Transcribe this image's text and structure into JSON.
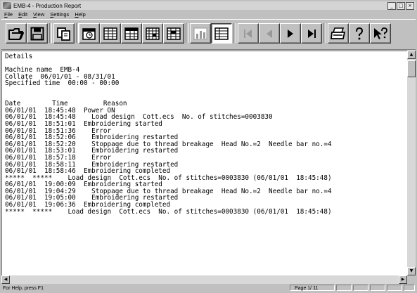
{
  "window": {
    "title": "EMB-4 - Production Report",
    "minimize": "_",
    "maximize": "□",
    "close": "×"
  },
  "menu": [
    {
      "underline": "F",
      "rest": "ile"
    },
    {
      "underline": "E",
      "rest": "dit"
    },
    {
      "underline": "V",
      "rest": "iew"
    },
    {
      "underline": "S",
      "rest": "ettings"
    },
    {
      "underline": "H",
      "rest": "elp"
    }
  ],
  "toolbar": {
    "buttons": [
      {
        "name": "open-button",
        "icon": "folder-open-icon"
      },
      {
        "name": "save-button",
        "icon": "floppy-disk-icon"
      },
      {
        "name": "copy-button",
        "icon": "copy-icon"
      },
      {
        "name": "calendar-button",
        "icon": "calendar-icon"
      },
      {
        "name": "monthly-report-button",
        "icon": "calendar-grid-icon"
      },
      {
        "name": "machine-report-button",
        "icon": "machine-grid-icon"
      },
      {
        "name": "period-report-button",
        "icon": "period-grid-icon"
      },
      {
        "name": "production-report-button",
        "icon": "production-grid-icon"
      },
      {
        "name": "graph-view-button",
        "icon": "bar-chart-icon"
      },
      {
        "name": "table-view-button",
        "icon": "table-icon"
      },
      {
        "name": "first-page-button",
        "icon": "first-page-icon"
      },
      {
        "name": "previous-page-button",
        "icon": "previous-page-icon"
      },
      {
        "name": "next-page-button",
        "icon": "next-page-icon"
      },
      {
        "name": "last-page-button",
        "icon": "last-page-icon"
      },
      {
        "name": "print-button",
        "icon": "printer-icon"
      },
      {
        "name": "help-button",
        "icon": "question-mark-icon"
      },
      {
        "name": "context-help-button",
        "icon": "context-help-icon"
      }
    ]
  },
  "report": {
    "lines": [
      "Details",
      "",
      "Machine name  EMB-4",
      "Collate  06/01/01 - 08/31/01",
      "Specified time  00:00 - 00:00",
      "",
      "",
      "Date        Time         Reason",
      "06/01/01  18:45:48  Power ON",
      "06/01/01  18:45:48    Load design  Cott.ecs  No. of stitches=0003830",
      "06/01/01  18:51:01  Embroidering started",
      "06/01/01  18:51:36    Error",
      "06/01/01  18:52:06    Embroidering restarted",
      "06/01/01  18:52:20    Stoppage due to thread breakage  Head No.=2  Needle bar no.=4",
      "06/01/01  18:53:01    Embroidering restarted",
      "06/01/01  18:57:18    Error",
      "06/01/01  18:58:11    Embroidering restarted",
      "06/01/01  18:58:46  Embroidering completed",
      "*****  *****    Load design  Cott.ecs  No. of stitches=0003830 (06/01/01  18:45:48)",
      "06/01/01  19:00:09  Embroidering started",
      "06/01/01  19:04:29    Stoppage due to thread breakage  Head No.=2  Needle bar no.=4",
      "06/01/01  19:05:00    Embroidering restarted",
      "06/01/01  19:06:36  Embroidering completed",
      "*****  *****    Load design  Cott.ecs  No. of stitches=0003830 (06/01/01  18:45:48)"
    ]
  },
  "scrollbar": {
    "up": "▲",
    "down": "▼",
    "left": "◀",
    "right": "▶"
  },
  "status": {
    "help_text": "For Help, press F1",
    "page": "Page  1/ 11"
  }
}
